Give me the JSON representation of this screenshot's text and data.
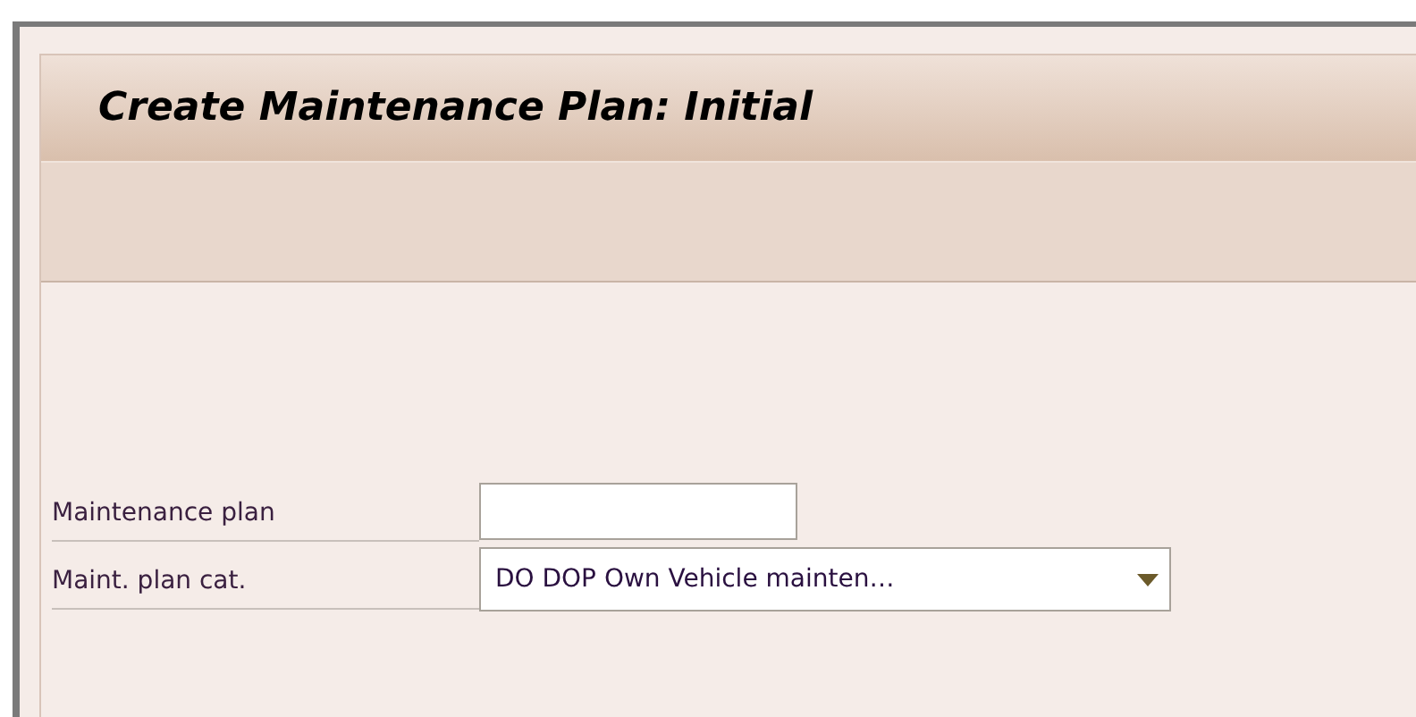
{
  "title": "Create Maintenance Plan: Initial",
  "fields": [
    {
      "label": "Maintenance plan",
      "kind": "input"
    },
    {
      "label": "Maint. plan cat.",
      "kind": "dropdown",
      "value": "DO DOP Own Vehicle mainten…"
    }
  ]
}
